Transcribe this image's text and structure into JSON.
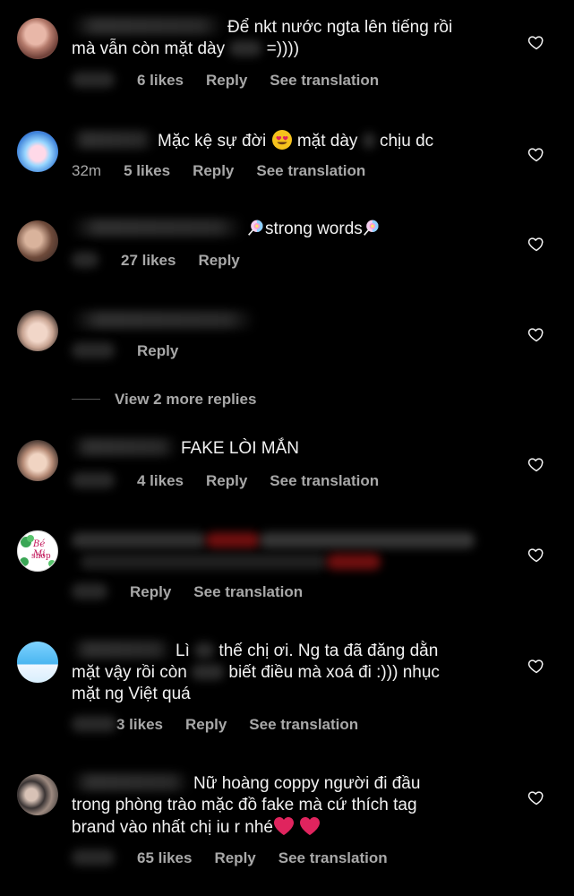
{
  "comments": [
    {
      "text_line1": "Để nkt nước ngta lên tiếng rồi",
      "text_line2_a": "mà vẫn còn mặt dày",
      "text_line2_b": "=))))",
      "likes": "6 likes",
      "reply": "Reply",
      "translate": "See translation"
    },
    {
      "text_a": "Mặc kệ sự đời",
      "text_b": "mặt dày",
      "text_c": "chịu dc",
      "time": "32m",
      "likes": "5 likes",
      "reply": "Reply",
      "translate": "See translation"
    },
    {
      "text": "strong words",
      "likes": "27 likes",
      "reply": "Reply"
    },
    {
      "reply": "Reply"
    },
    {
      "view_replies": "View 2 more replies"
    },
    {
      "text": "FAKE LÒI MẮN",
      "likes": "4 likes",
      "reply": "Reply",
      "translate": "See translation"
    },
    {
      "avatar_text_1": "Bé Mi",
      "avatar_text_2": "shop",
      "reply": "Reply",
      "translate": "See translation"
    },
    {
      "text_a": "Lì",
      "text_b": "thế chị ơi. Ng ta đã đăng dằn",
      "text_c": "mặt vậy rồi còn",
      "text_d": "biết điều mà xoá đi :))) nhục",
      "text_e": "mặt ng Việt quá",
      "likes": "3 likes",
      "reply": "Reply",
      "translate": "See translation"
    },
    {
      "text_line1": "Nữ hoàng coppy người đi đầu",
      "text_line2": "trong phòng trào mặc đồ fake mà cứ thích tag",
      "text_line3": "brand vào nhất chị iu r nhé",
      "likes": "65 likes",
      "reply": "Reply",
      "translate": "See translation"
    }
  ],
  "colors": {
    "background": "#000000",
    "text": "#f2f2f2",
    "meta": "#a8a8a8",
    "heart_emoji": "#e0245e"
  },
  "icons": {
    "like": "heart-outline-icon"
  }
}
